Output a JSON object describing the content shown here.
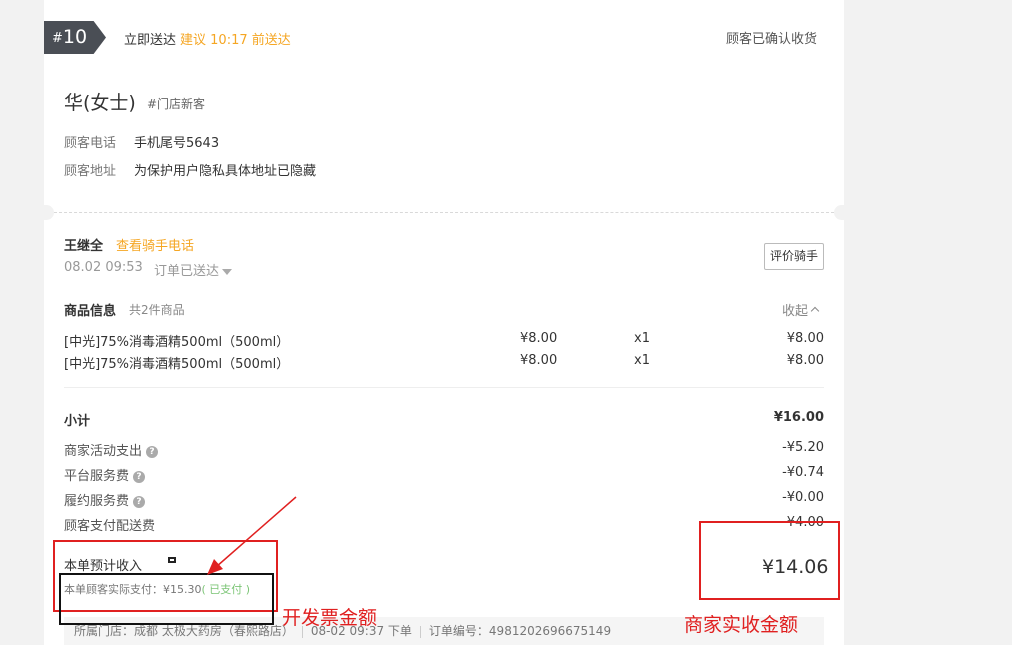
{
  "header": {
    "order_no_hash": "#",
    "order_no": "10",
    "deliver_now": "立即送达",
    "suggest": "建议 10:17 前送达",
    "status": "顾客已确认收货"
  },
  "customer": {
    "name": "华(女士)",
    "tag": "#门店新客",
    "phone_label": "顾客电话",
    "phone_value": "手机尾号5643",
    "address_label": "顾客地址",
    "address_value": "为保护用户隐私具体地址已隐藏"
  },
  "rider": {
    "name": "王继全",
    "link": "查看骑手电话",
    "time": "08.02 09:53",
    "status": "订单已送达",
    "rate_button": "评价骑手"
  },
  "goods": {
    "title": "商品信息",
    "count": "共2件商品",
    "collapse": "收起",
    "items": [
      {
        "name": "[中光]75%消毒酒精500ml（500ml）",
        "price": "¥8.00",
        "qty": "x1",
        "total": "¥8.00"
      },
      {
        "name": "[中光]75%消毒酒精500ml（500ml）",
        "price": "¥8.00",
        "qty": "x1",
        "total": "¥8.00"
      }
    ]
  },
  "summary": {
    "subtotal_label": "小计",
    "subtotal_value": "¥16.00",
    "lines": [
      {
        "label": "商家活动支出",
        "value": "-¥5.20"
      },
      {
        "label": "平台服务费",
        "value": "-¥0.74"
      },
      {
        "label": "履约服务费",
        "value": "-¥0.00"
      },
      {
        "label": "顾客支付配送费",
        "value": "¥4.00"
      }
    ],
    "income_label": "本单预计收入",
    "income_value": "¥14.06",
    "paid_text": "本单顾客实际支付：¥15.30",
    "paid_status": "( 已支付 )"
  },
  "footer": {
    "store": "所属门店：成都 太极大药房（春熙路店）",
    "time": "08-02 09:37 下单",
    "order_id": "订单编号：4981202696675149"
  },
  "annotations": {
    "invoice_note": "开发票金额",
    "merchant_note": "商家实收金额",
    "color": "#e02020"
  }
}
